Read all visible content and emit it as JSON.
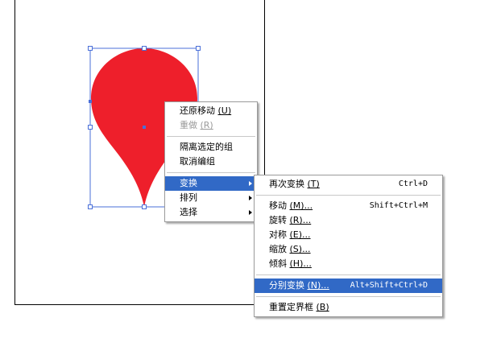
{
  "colors": {
    "shape_fill": "#ee1f2b",
    "selection": "#4a6fd8",
    "menu_highlight": "#3169c6"
  },
  "context_menu": {
    "items": [
      {
        "label": "还原移动",
        "mnemonic": "(U)",
        "disabled": false
      },
      {
        "label": "重做",
        "mnemonic": "(R)",
        "disabled": true
      },
      {
        "label": "隔离选定的组"
      },
      {
        "label": "取消编组"
      },
      {
        "label": "变换",
        "submenu": true,
        "highlighted": true
      },
      {
        "label": "排列",
        "submenu": true
      },
      {
        "label": "选择",
        "submenu": true
      }
    ]
  },
  "transform_submenu": {
    "items": [
      {
        "label": "再次变换",
        "mnemonic": "(T)",
        "shortcut": "Ctrl+D"
      },
      {
        "label": "移动",
        "mnemonic": "(M)...",
        "shortcut": "Shift+Ctrl+M"
      },
      {
        "label": "旋转",
        "mnemonic": "(R)..."
      },
      {
        "label": "对称",
        "mnemonic": "(E)..."
      },
      {
        "label": "缩放",
        "mnemonic": "(S)..."
      },
      {
        "label": "倾斜",
        "mnemonic": "(H)..."
      },
      {
        "label": "分别变换",
        "mnemonic": "(N)...",
        "shortcut": "Alt+Shift+Ctrl+D",
        "highlighted": true
      },
      {
        "label": "重置定界框",
        "mnemonic": "(B)"
      }
    ]
  }
}
